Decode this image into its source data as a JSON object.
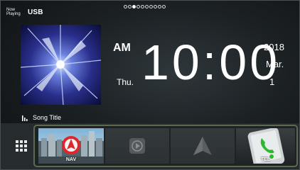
{
  "header": {
    "now_playing": "Now Playing",
    "source": "USB",
    "page_count": 10,
    "active_page": 3
  },
  "track": {
    "title": "Song Title"
  },
  "clock": {
    "ampm": "AM",
    "time": "10:00",
    "day": "Thu.",
    "year": "2018",
    "month": "Mar.",
    "date": "1"
  },
  "dock": {
    "apps": [
      {
        "label": "NAV",
        "icon": "navigation-map-icon"
      },
      {
        "label": "",
        "icon": "media-play-icon"
      },
      {
        "label": "",
        "icon": "android-auto-icon"
      },
      {
        "label": "TEL",
        "icon": "phone-icon"
      }
    ]
  },
  "colors": {
    "accent_border": "#5a6b52",
    "nav_arrow": "#e0262a",
    "phone_green": "#2eb82e"
  }
}
